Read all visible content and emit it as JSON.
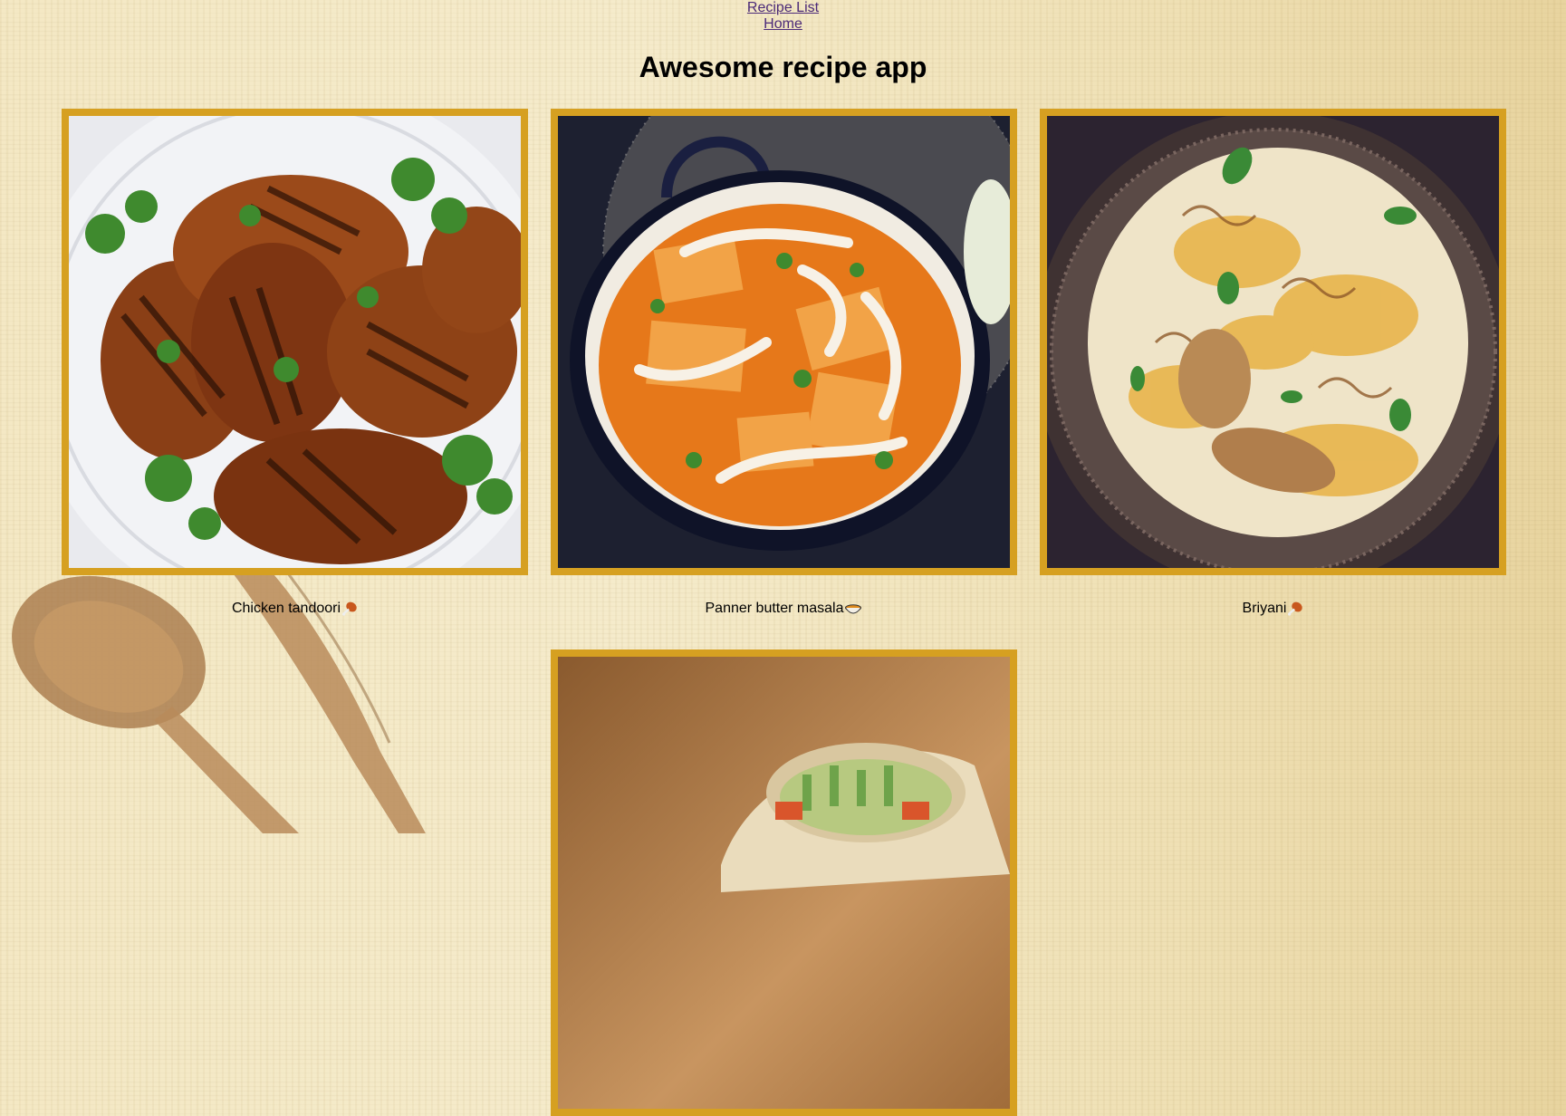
{
  "nav": {
    "links": [
      "Recipe List",
      "Home"
    ]
  },
  "header": {
    "title": "Awesome recipe app"
  },
  "recipes": [
    {
      "name": "Chicken tandoori",
      "emoji_icon": "drumstick-icon"
    },
    {
      "name": "Panner butter masala",
      "emoji_icon": "curry-bowl-icon"
    },
    {
      "name": "Briyani",
      "emoji_icon": "drumstick-icon"
    },
    {
      "name": "",
      "emoji_icon": ""
    }
  ],
  "colors": {
    "frame": "#d6a021",
    "link": "#4b2a78",
    "background": "#f4e8c4"
  }
}
